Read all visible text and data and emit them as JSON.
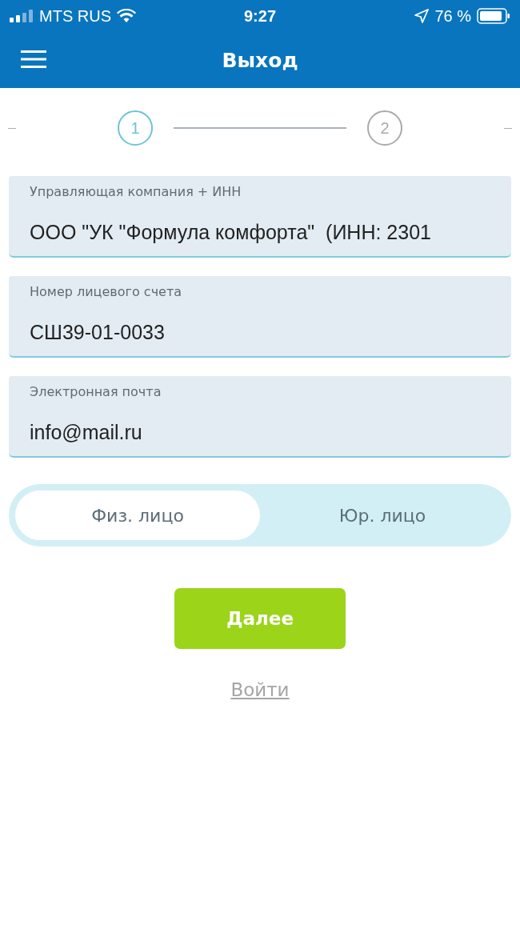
{
  "status_bar": {
    "carrier": "MTS RUS",
    "time": "9:27",
    "battery": "76 %"
  },
  "header": {
    "title": "Выход"
  },
  "stepper": [
    {
      "label": "1",
      "active": true
    },
    {
      "label": "2",
      "active": false
    }
  ],
  "fields": [
    {
      "label": "Управляющая компания + ИНН",
      "value": "ООО \"УК \"Формула комфорта\"  (ИНН: 2301"
    },
    {
      "label": "Номер лицевого счета",
      "value": "СШ39-01-0033"
    },
    {
      "label": "Электронная почта",
      "value": "info@mail.ru"
    }
  ],
  "segments": [
    {
      "label": "Физ. лицо",
      "selected": true
    },
    {
      "label": "Юр. лицо",
      "selected": false
    }
  ],
  "next_button": "Далее",
  "login_link": "Войти"
}
